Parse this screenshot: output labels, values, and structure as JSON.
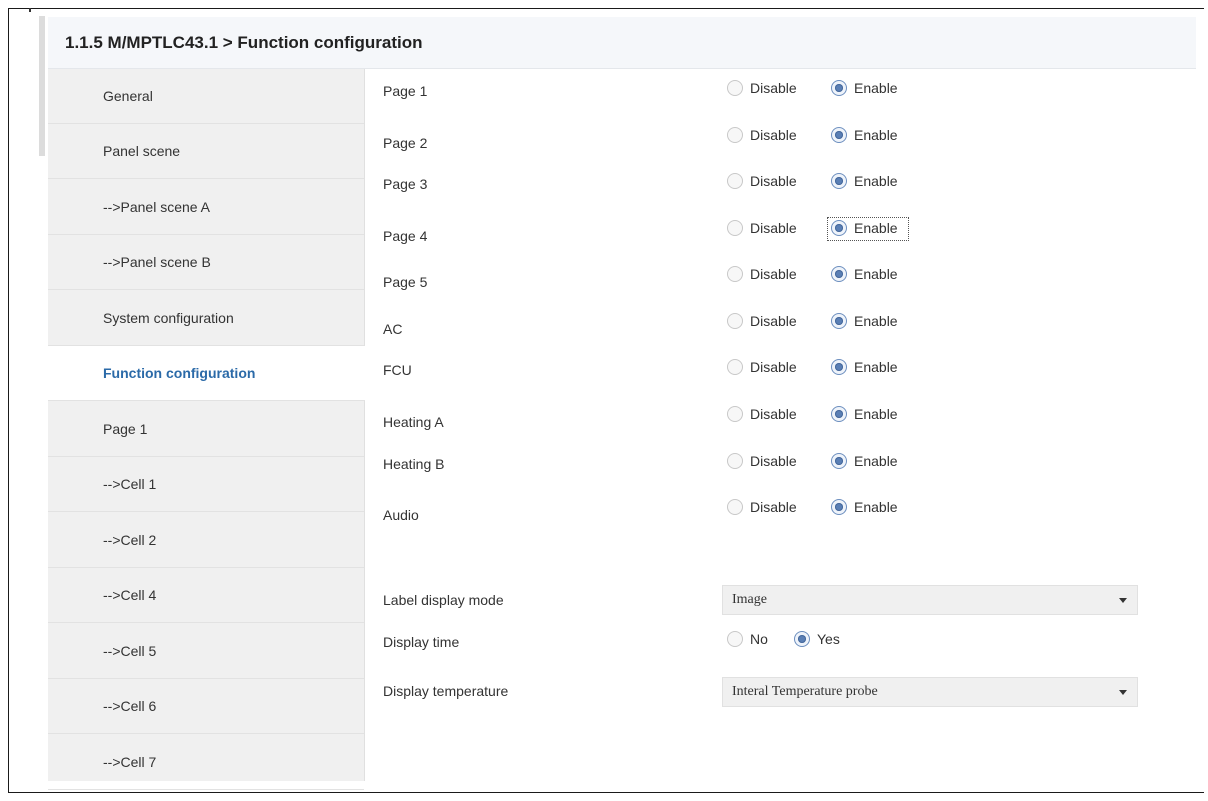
{
  "header": {
    "title": "1.1.5 M/MPTLC43.1 > Function configuration"
  },
  "sidebar": {
    "items": [
      {
        "label": "General",
        "active": false
      },
      {
        "label": "Panel scene",
        "active": false
      },
      {
        "label": "-->Panel scene A",
        "active": false
      },
      {
        "label": "-->Panel scene B",
        "active": false
      },
      {
        "label": "System configuration",
        "active": false
      },
      {
        "label": "Function configuration",
        "active": true
      },
      {
        "label": "Page 1",
        "active": false
      },
      {
        "label": "-->Cell 1",
        "active": false
      },
      {
        "label": "-->Cell 2",
        "active": false
      },
      {
        "label": "-->Cell 4",
        "active": false
      },
      {
        "label": "-->Cell 5",
        "active": false
      },
      {
        "label": "-->Cell 6",
        "active": false
      },
      {
        "label": "-->Cell 7",
        "active": false
      }
    ]
  },
  "params": {
    "rows": [
      {
        "label": "Page 1",
        "options": [
          "Disable",
          "Enable"
        ],
        "selected": "Enable"
      },
      {
        "label": "Page 2",
        "options": [
          "Disable",
          "Enable"
        ],
        "selected": "Enable"
      },
      {
        "label": "Page 3",
        "options": [
          "Disable",
          "Enable"
        ],
        "selected": "Enable"
      },
      {
        "label": "Page 4",
        "options": [
          "Disable",
          "Enable"
        ],
        "selected": "Enable",
        "focused": "Enable"
      },
      {
        "label": "Page 5",
        "options": [
          "Disable",
          "Enable"
        ],
        "selected": "Enable"
      },
      {
        "label": "AC",
        "options": [
          "Disable",
          "Enable"
        ],
        "selected": "Enable"
      },
      {
        "label": "FCU",
        "options": [
          "Disable",
          "Enable"
        ],
        "selected": "Enable"
      },
      {
        "label": "Heating A",
        "options": [
          "Disable",
          "Enable"
        ],
        "selected": "Enable"
      },
      {
        "label": "Heating B",
        "options": [
          "Disable",
          "Enable"
        ],
        "selected": "Enable"
      },
      {
        "label": "Audio",
        "options": [
          "Disable",
          "Enable"
        ],
        "selected": "Enable"
      }
    ],
    "label_display_mode": {
      "label": "Label display mode",
      "value": "Image"
    },
    "display_time": {
      "label": "Display time",
      "options": [
        "No",
        "Yes"
      ],
      "selected": "Yes"
    },
    "display_temperature": {
      "label": "Display temperature",
      "value": "Interal Temperature probe"
    }
  },
  "colors": {
    "active_nav_text": "#2b6aa8",
    "radio_checked": "#5a7fb5",
    "sidebar_bg": "#f0f0f0",
    "header_bg": "#f5f7fa"
  },
  "icons": {
    "dropdown": "chevron-down-icon"
  }
}
